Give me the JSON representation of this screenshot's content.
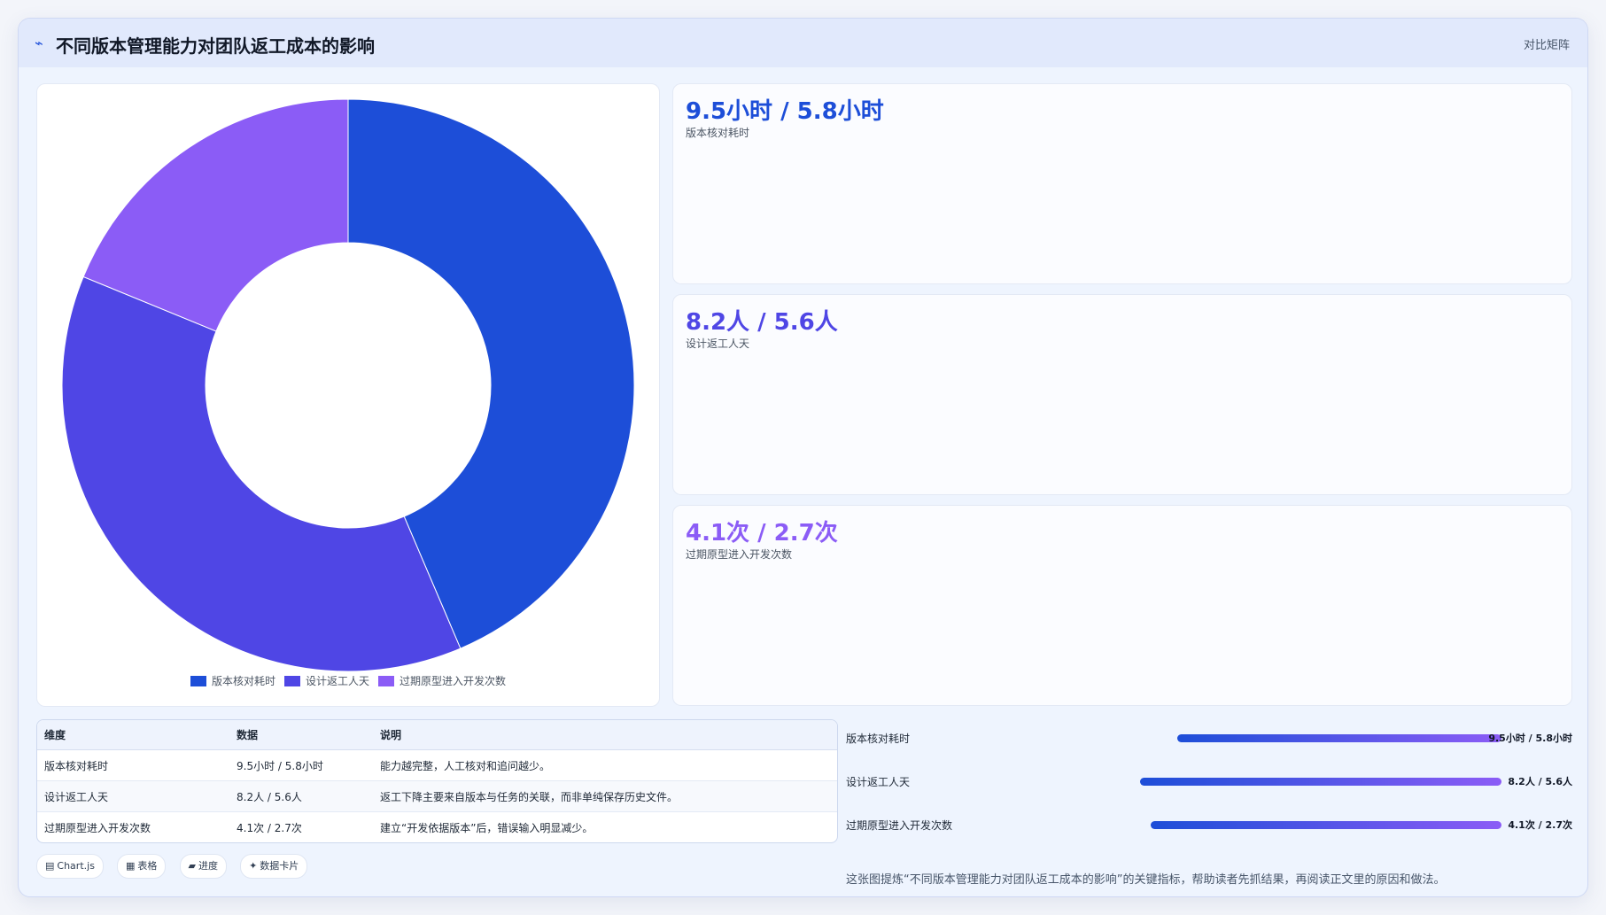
{
  "header": {
    "icon": "trend-icon",
    "title": "不同版本管理能力对团队返工成本的影响",
    "tag": "对比矩阵"
  },
  "colors": {
    "blue": "#1d4ed8",
    "indigo": "#4f46e5",
    "violet": "#8b5cf6"
  },
  "chart_data": {
    "type": "pie",
    "style": "donut",
    "labels": [
      "版本核对耗时",
      "设计返工人天",
      "过期原型进入开发次数"
    ],
    "values": [
      9.5,
      8.2,
      4.1
    ],
    "colors": [
      "#1d4ed8",
      "#4f46e5",
      "#8b5cf6"
    ],
    "legend_position": "bottom"
  },
  "kpis": [
    {
      "value": "9.5小时 / 5.8小时",
      "label": "版本核对耗时",
      "color": "#1d4ed8"
    },
    {
      "value": "8.2人 / 5.6人",
      "label": "设计返工人天",
      "color": "#4f46e5"
    },
    {
      "value": "4.1次 / 2.7次",
      "label": "过期原型进入开发次数",
      "color": "#8b5cf6"
    }
  ],
  "table": {
    "headers": [
      "维度",
      "数据",
      "说明"
    ],
    "rows": [
      [
        "版本核对耗时",
        "9.5小时 / 5.8小时",
        "能力越完整，人工核对和追问越少。"
      ],
      [
        "设计返工人天",
        "8.2人 / 5.6人",
        "返工下降主要来自版本与任务的关联，而非单纯保存历史文件。"
      ],
      [
        "过期原型进入开发次数",
        "4.1次 / 2.7次",
        "建立“开发依据版本”后，错误输入明显减少。"
      ]
    ]
  },
  "chips": [
    {
      "icon": "▤",
      "label": "Chart.js"
    },
    {
      "icon": "▦",
      "label": "表格"
    },
    {
      "icon": "▰",
      "label": "进度"
    },
    {
      "icon": "✦",
      "label": "数据卡片"
    }
  ],
  "progress": [
    {
      "label": "版本核对耗时",
      "value": "9.5小时 / 5.8小时",
      "fraction": 0.61
    },
    {
      "label": "设计返工人天",
      "value": "8.2人 / 5.6人",
      "fraction": 0.68
    },
    {
      "label": "过期原型进入开发次数",
      "value": "4.1次 / 2.7次",
      "fraction": 0.66
    }
  ],
  "note": "这张图提炼“不同版本管理能力对团队返工成本的影响”的关键指标，帮助读者先抓结果，再阅读正文里的原因和做法。"
}
